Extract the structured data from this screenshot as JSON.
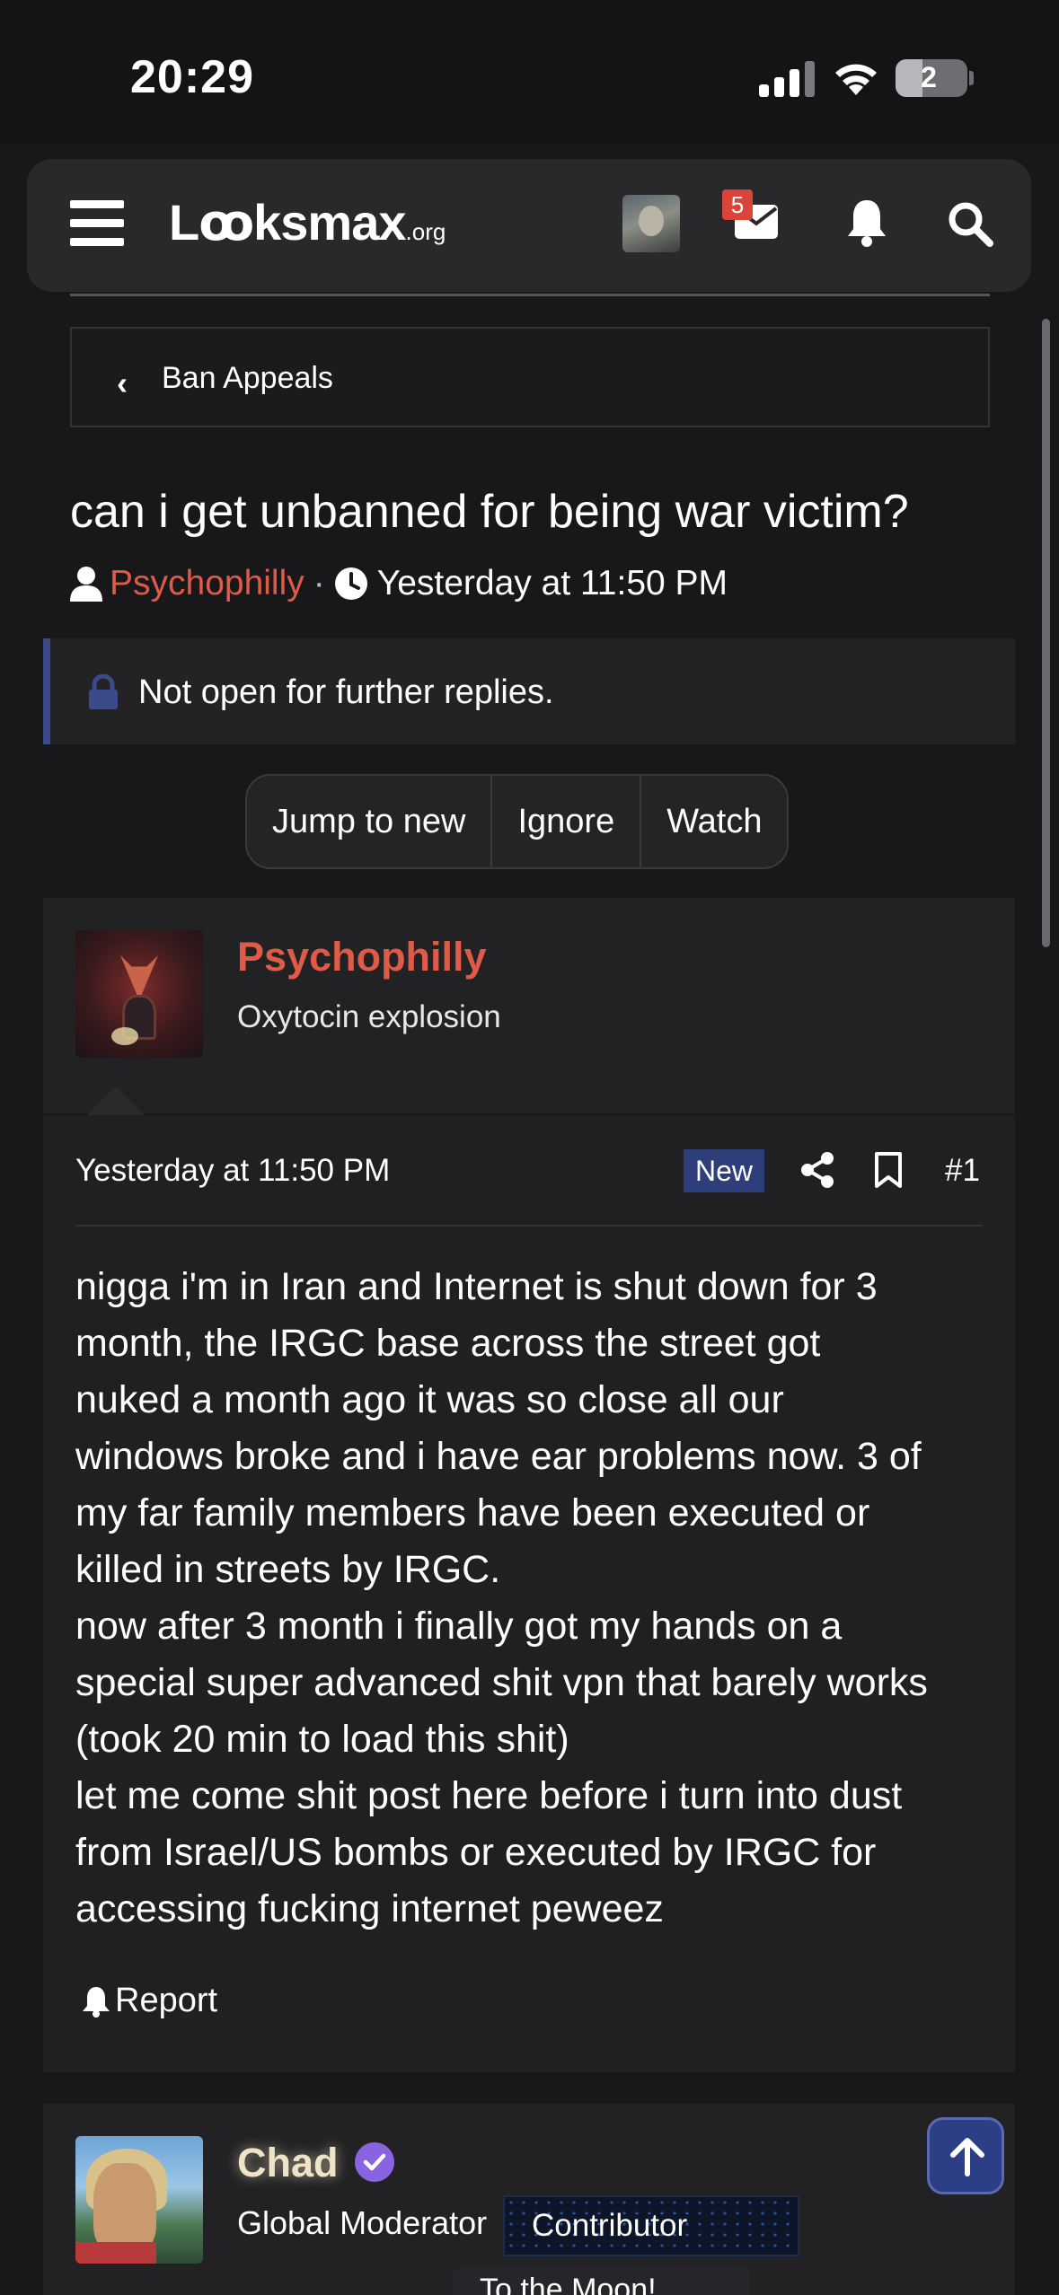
{
  "status_bar": {
    "time": "20:29",
    "battery_level": "2"
  },
  "navbar": {
    "logo_main": "Lꝏksmax",
    "logo_suffix": ".org",
    "mail_badge_count": "5"
  },
  "breadcrumb": {
    "label": "Ban Appeals"
  },
  "thread": {
    "title": "can i get unbanned for being war victim?",
    "author": "Psychophilly",
    "separator": "·",
    "date": "Yesterday at 11:50 PM"
  },
  "notice": {
    "text": "Not open for further replies."
  },
  "actions": {
    "jump_to_new": "Jump to new",
    "ignore": "Ignore",
    "watch": "Watch"
  },
  "post": {
    "username": "Psychophilly",
    "user_title": "Oxytocin explosion",
    "date": "Yesterday at 11:50 PM",
    "new_badge": "New",
    "number": "#1",
    "lines": [
      "nigga i'm in Iran and Internet is shut down for 3",
      "month, the IRGC base across the street got",
      "nuked a month ago it was so close all our",
      "windows broke and i have ear problems now. 3 of",
      "my far family members have been executed or",
      "killed in streets by IRGC.",
      "now after 3 month i finally got my hands on a",
      "special super advanced shit vpn that barely works",
      "(took 20 min to load this shit)",
      "let me come shit post here before i turn into dust",
      "from Israel/US bombs or executed by IRGC for",
      "accessing fucking internet peweez"
    ],
    "report_label": "Report"
  },
  "next_post": {
    "username": "Chad",
    "role": "Global Moderator",
    "badge": "Contributor",
    "badge2": "To the Moon!"
  },
  "colors": {
    "accent_red": "#e05a48",
    "badge_blue": "#2e3e7a",
    "verified_purple": "#8a64e0"
  },
  "icons": [
    "hamburger-icon",
    "mail-icon",
    "bell-icon",
    "search-icon",
    "chevron-left-icon",
    "user-icon",
    "clock-icon",
    "lock-icon",
    "share-icon",
    "bookmark-icon",
    "bell-report-icon",
    "verified-icon",
    "arrow-up-icon"
  ]
}
